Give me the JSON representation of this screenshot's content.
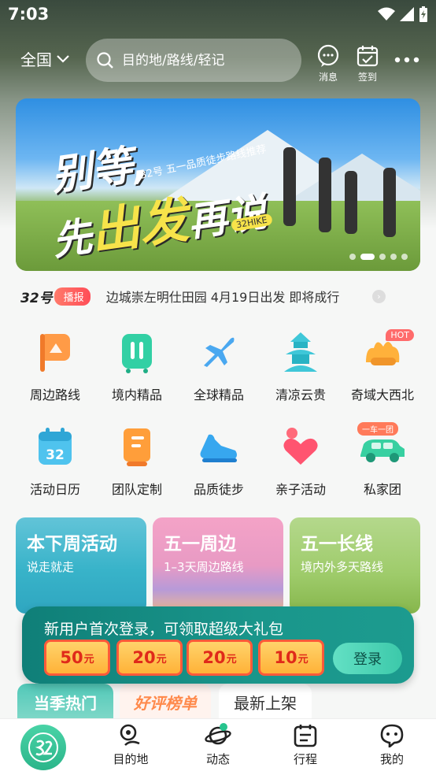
{
  "status_bar": {
    "time": "7:03"
  },
  "header": {
    "city": "全国",
    "search_placeholder": "目的地/路线/轻记",
    "messages_label": "消息",
    "checkin_label": "签到"
  },
  "banner": {
    "title_line1": "别等,",
    "title_line2_a": "先",
    "title_line2_b": "出发",
    "title_line2_c": "再说",
    "subtitle": "32号 五一品质徒步路线推荐",
    "tag": "32HIKE",
    "active_dot": 1
  },
  "news": {
    "brand": "32号",
    "badge": "播报",
    "text": "边城崇左明仕田园 4月19日出发 即将成行"
  },
  "categories": [
    {
      "label": "周边路线",
      "icon": "flag-icon"
    },
    {
      "label": "境内精品",
      "icon": "luggage-icon"
    },
    {
      "label": "全球精品",
      "icon": "airplane-icon"
    },
    {
      "label": "清凉云贵",
      "icon": "pagoda-icon"
    },
    {
      "label": "奇域大西北",
      "icon": "camel-icon",
      "badge": "HOT"
    },
    {
      "label": "活动日历",
      "icon": "calendar-icon"
    },
    {
      "label": "团队定制",
      "icon": "book-icon"
    },
    {
      "label": "品质徒步",
      "icon": "shoe-icon"
    },
    {
      "label": "亲子活动",
      "icon": "heart-icon"
    },
    {
      "label": "私家团",
      "icon": "car-icon",
      "badge": "一车一团"
    }
  ],
  "promo_cards": [
    {
      "title": "本下周活动",
      "subtitle": "说走就走"
    },
    {
      "title": "五一周边",
      "subtitle": "1–3天周边路线"
    },
    {
      "title": "五一长线",
      "subtitle": "境内外多天路线"
    }
  ],
  "login_popup": {
    "text": "新用户首次登录，可领取超级大礼包",
    "coupons": [
      {
        "amount": "50",
        "unit": "元"
      },
      {
        "amount": "20",
        "unit": "元"
      },
      {
        "amount": "20",
        "unit": "元"
      },
      {
        "amount": "10",
        "unit": "元"
      }
    ],
    "button": "登录"
  },
  "tabs": [
    "当季热门",
    "好评榜单",
    "最新上架"
  ],
  "bottom_nav": [
    "目的地",
    "动态",
    "行程",
    "我的"
  ],
  "colors": {
    "accent": "#2bb58a",
    "popup": "#1a968b",
    "coupon_border": "#ff5a3a"
  }
}
